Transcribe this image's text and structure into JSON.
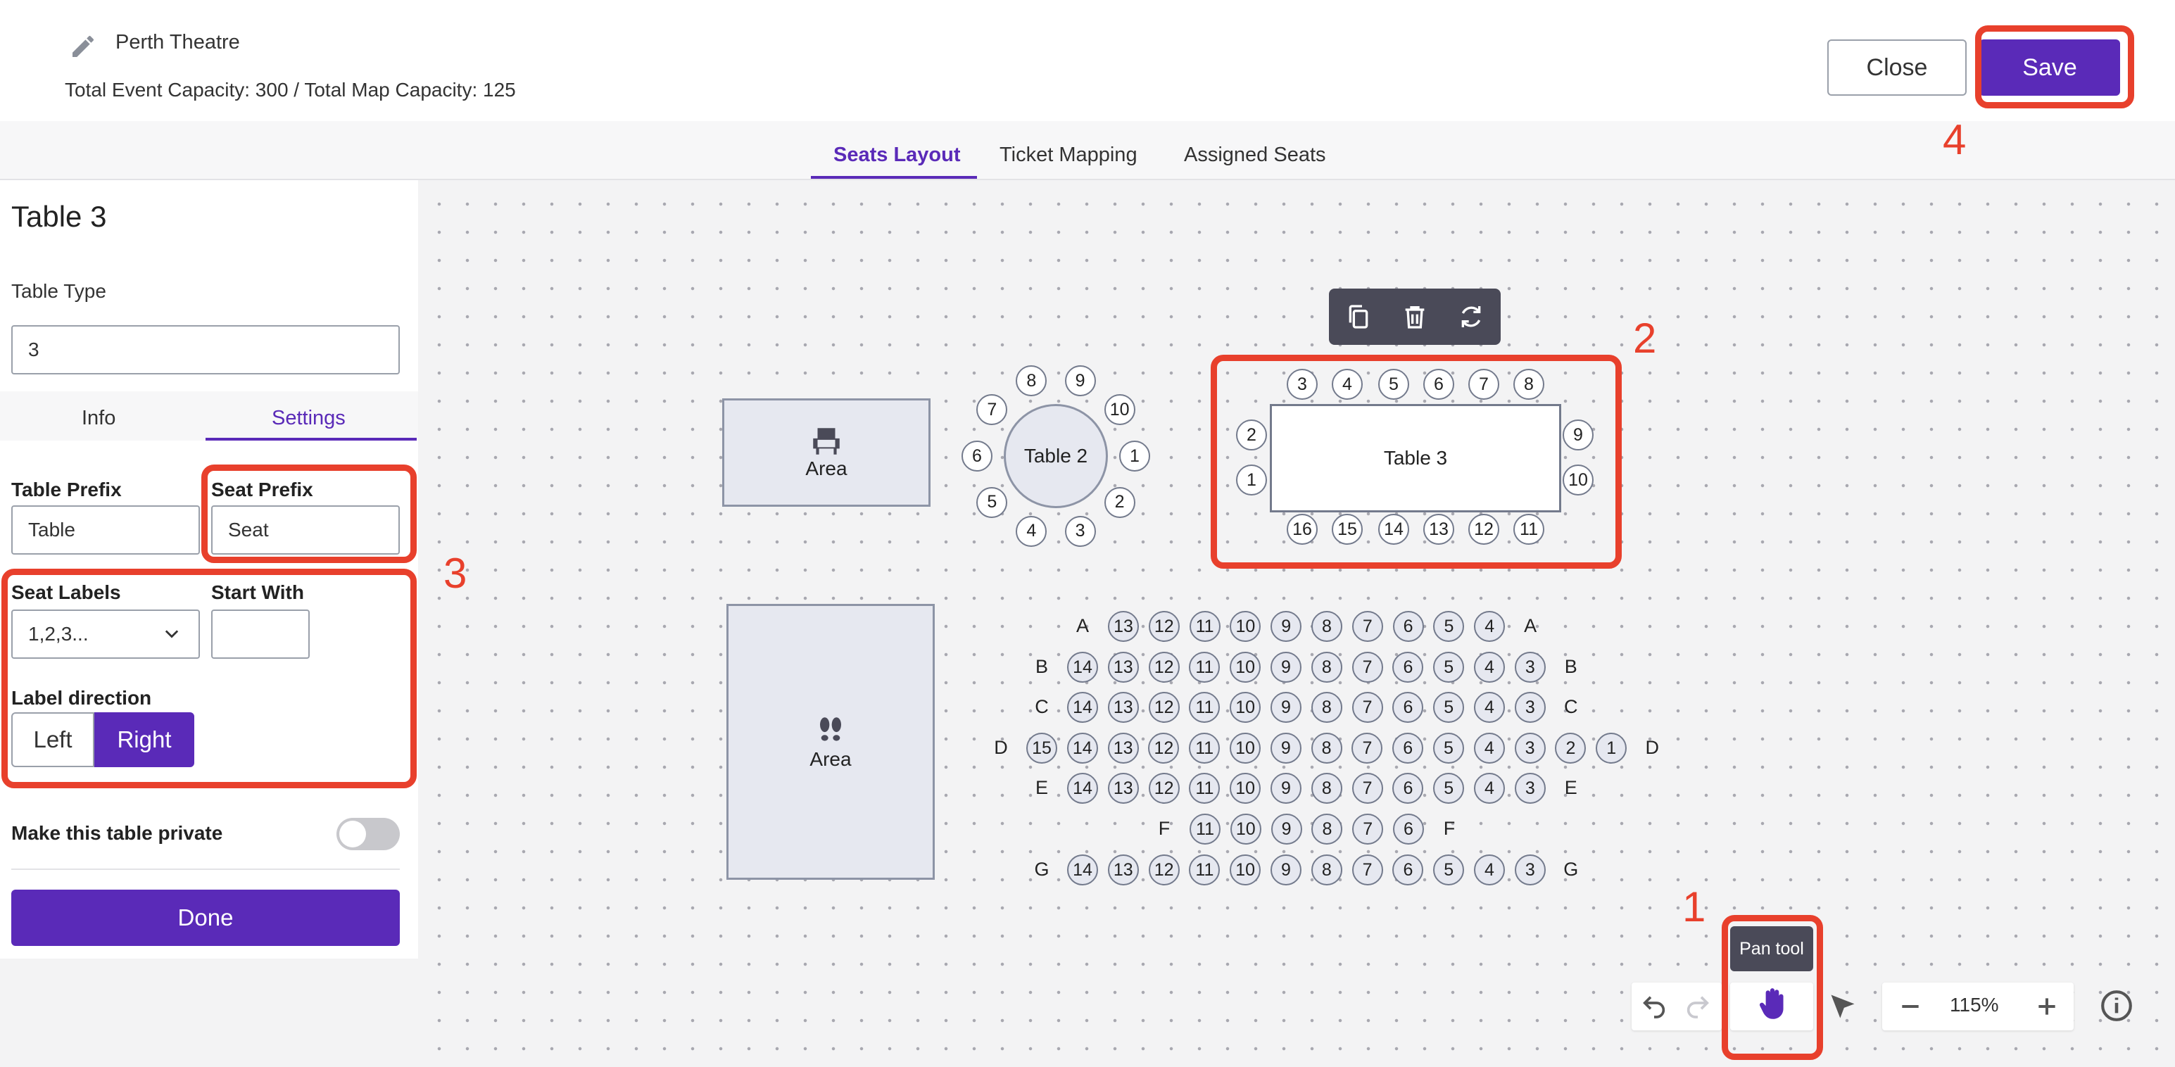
{
  "header": {
    "event_name": "Perth Theatre",
    "capacity": "Total Event Capacity: 300 / Total Map Capacity: 125",
    "close_label": "Close",
    "save_label": "Save"
  },
  "tabs": [
    {
      "label": "Seats Layout",
      "active": true
    },
    {
      "label": "Ticket Mapping",
      "active": false
    },
    {
      "label": "Assigned Seats",
      "active": false
    }
  ],
  "panel": {
    "title": "Table 3",
    "table_type_label": "Table Type",
    "table_type_value": "3",
    "subtabs": [
      "Info",
      "Settings"
    ],
    "table_prefix_label": "Table Prefix",
    "table_prefix_value": "Table",
    "seat_prefix_label": "Seat Prefix",
    "seat_prefix_value": "Seat",
    "seat_labels_label": "Seat Labels",
    "seat_labels_value": "1,2,3...",
    "start_with_label": "Start With",
    "start_with_value": "",
    "label_direction_label": "Label direction",
    "direction_left": "Left",
    "direction_right": "Right",
    "private_label": "Make this table private",
    "done_label": "Done"
  },
  "map": {
    "area1_label": "Area",
    "area2_label": "Area",
    "table2_label": "Table 2",
    "table3_label": "Table 3",
    "table2_seats": [
      "8",
      "9",
      "10",
      "1",
      "2",
      "3",
      "4",
      "5",
      "6",
      "7"
    ],
    "table3_top": [
      "3",
      "4",
      "5",
      "6",
      "7",
      "8"
    ],
    "table3_bottom": [
      "16",
      "15",
      "14",
      "13",
      "12",
      "11"
    ],
    "table3_left": [
      "2",
      "1"
    ],
    "table3_right": [
      "9",
      "10"
    ],
    "rows": [
      {
        "label": "A",
        "seats": [
          "13",
          "12",
          "11",
          "10",
          "9",
          "8",
          "7",
          "6",
          "5",
          "4"
        ]
      },
      {
        "label": "B",
        "seats": [
          "14",
          "13",
          "12",
          "11",
          "10",
          "9",
          "8",
          "7",
          "6",
          "5",
          "4",
          "3"
        ]
      },
      {
        "label": "C",
        "seats": [
          "14",
          "13",
          "12",
          "11",
          "10",
          "9",
          "8",
          "7",
          "6",
          "5",
          "4",
          "3"
        ]
      },
      {
        "label": "D",
        "seats": [
          "15",
          "14",
          "13",
          "12",
          "11",
          "10",
          "9",
          "8",
          "7",
          "6",
          "5",
          "4",
          "3",
          "2",
          "1"
        ]
      },
      {
        "label": "E",
        "seats": [
          "14",
          "13",
          "12",
          "11",
          "10",
          "9",
          "8",
          "7",
          "6",
          "5",
          "4",
          "3"
        ]
      },
      {
        "label": "F",
        "seats": [
          "11",
          "10",
          "9",
          "8",
          "7",
          "6"
        ]
      },
      {
        "label": "G",
        "seats": [
          "14",
          "13",
          "12",
          "11",
          "10",
          "9",
          "8",
          "7",
          "6",
          "5",
          "4",
          "3"
        ]
      }
    ]
  },
  "tools": {
    "tooltip": "Pan tool",
    "zoom": "115%"
  },
  "annotations": [
    "1",
    "2",
    "3",
    "4"
  ],
  "colors": {
    "accent": "#5a2ab8",
    "annotation": "#e8402c"
  }
}
